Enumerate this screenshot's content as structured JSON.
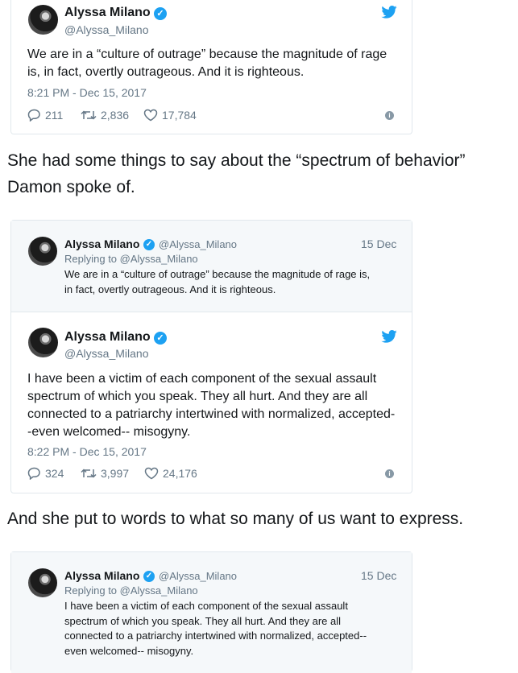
{
  "author": {
    "name": "Alyssa Milano",
    "handle": "@Alyssa_Milano",
    "verified": true
  },
  "tweet1": {
    "text_lines": [
      "We are in a “culture of outrage” because the magnitude of rage",
      "is, in fact, overtly outrageous. And it is righteous."
    ],
    "timestamp": "8:21 PM - Dec 15, 2017",
    "replies": "211",
    "retweets": "2,836",
    "likes": "17,784"
  },
  "para1": {
    "lines": [
      "She had some things to say about the “spectrum of behavior”",
      "Damon spoke of."
    ]
  },
  "tweet2": {
    "quote": {
      "date": "15 Dec",
      "replying_to": "Replying to @Alyssa_Milano",
      "text_lines": [
        "We are in a “culture of outrage” because the magnitude of rage is,",
        "in fact, overtly outrageous. And it is righteous."
      ]
    },
    "text_lines": [
      "I have been a victim of each component of the sexual assault",
      "spectrum of which you speak. They all hurt. And they are all",
      "connected to a patriarchy intertwined with normalized, accepted-",
      "-even welcomed-- misogyny."
    ],
    "timestamp": "8:22 PM - Dec 15, 2017",
    "replies": "324",
    "retweets": "3,997",
    "likes": "24,176"
  },
  "para2": {
    "text": "And she put to words to what so many of us want to express."
  },
  "tweet3": {
    "quote": {
      "date": "15 Dec",
      "replying_to": "Replying to @Alyssa_Milano",
      "text_lines": [
        "I have been a victim of each component of the sexual assault",
        "spectrum of which you speak. They all hurt. And they are all",
        "connected to a patriarchy intertwined with normalized, accepted--",
        "even welcomed-- misogyny."
      ]
    }
  },
  "colors": {
    "twitter_blue": "#1da1f2",
    "secondary_text": "#657786",
    "border": "#e1e8ed",
    "quote_bg": "#f5f8fa"
  }
}
